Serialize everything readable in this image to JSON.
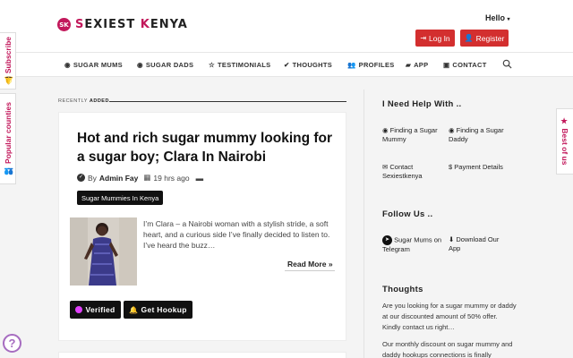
{
  "brand": {
    "badge": "SK",
    "name_part1": "S",
    "name_part2": "EXIEST ",
    "name_part3": "K",
    "name_part4": "ENYA"
  },
  "header": {
    "hello": "Hello",
    "login": "Log In",
    "register": "Register"
  },
  "nav": [
    {
      "label": "SUGAR MUMS",
      "icon": "user-circle-icon"
    },
    {
      "label": "SUGAR DADS",
      "icon": "user-circle-icon"
    },
    {
      "label": "TESTIMONIALS",
      "icon": "star-icon"
    },
    {
      "label": "THOUGHTS",
      "icon": "check-circle-icon"
    },
    {
      "label": "PROFILES",
      "icon": "users-icon"
    },
    {
      "label": "APP",
      "icon": "app-icon"
    },
    {
      "label": "CONTACT",
      "icon": "address-book-icon"
    }
  ],
  "side_tabs": {
    "subscribe": "Subscribe",
    "popular": "Popular counties",
    "best": "Best of us"
  },
  "recent": {
    "prefix": "RECENTLY ",
    "bold": "ADDED"
  },
  "post": {
    "title": "Hot and rich sugar mummy looking for a sugar boy; Clara In Nairobi",
    "by": "By",
    "author": "Admin Fay",
    "time": "19 hrs ago",
    "tag": "Sugar Mummies In Kenya",
    "excerpt": "I’m Clara – a Nairobi woman with a stylish stride, a soft heart, and a curious side I’ve finally decided to listen to. I’ve heard the buzz…",
    "read_more": "Read More »",
    "verified": "Verified",
    "hookup": "Get Hookup"
  },
  "sidebar": {
    "help_heading": "I Need Help With ..",
    "links": [
      {
        "label": "Finding a Sugar Mummy",
        "icon": "user-circle-icon"
      },
      {
        "label": "Finding a Sugar Daddy",
        "icon": "user-circle-icon"
      },
      {
        "label": "Contact Sexiestkenya",
        "icon": "envelope-icon"
      },
      {
        "label": "Payment Details",
        "icon": "dollar-icon"
      }
    ],
    "follow_heading": "Follow Us ..",
    "telegram": "Sugar Mums on Telegram",
    "download": "Download Our App",
    "thoughts_heading": "Thoughts",
    "thought1": "Are you looking for a sugar mummy or daddy at our discounted amount of 50% offer. Kindly contact us right…",
    "thought2": "Our monthly discount on sugar mummy and daddy hookups connections is finally"
  },
  "colors": {
    "accent": "#c2185b",
    "button_red": "#d32f2f",
    "button_black": "#111111"
  }
}
